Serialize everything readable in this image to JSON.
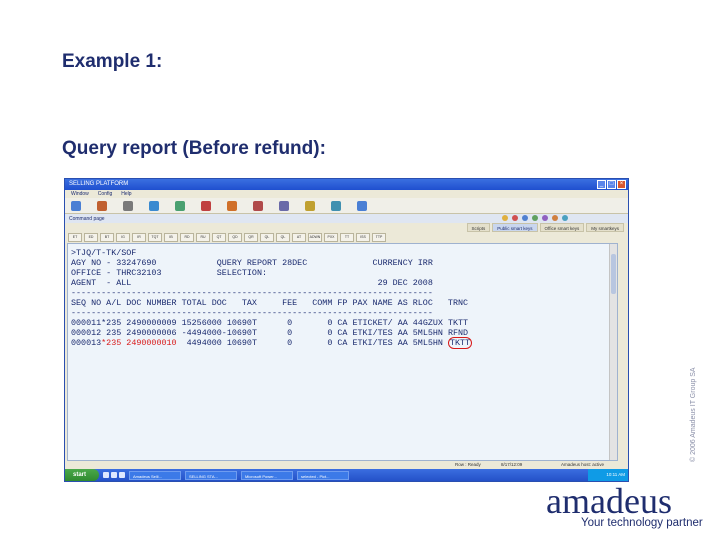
{
  "slide": {
    "heading1": "Example 1:",
    "heading2": "Query report (Before refund):",
    "copyright": "© 2006 Amadeus IT Group SA"
  },
  "window": {
    "title": "SELLING PLATFORM",
    "menu": [
      "Window",
      "Config",
      "Help"
    ],
    "toolbar_icons": [
      "home-icon",
      "users-icon",
      "car-icon",
      "plane-icon",
      "hotel-icon",
      "ship-icon",
      "person-icon",
      "person-icon",
      "calendar-icon",
      "mail-icon",
      "globe-icon",
      "plane-icon"
    ],
    "command_label": "Command page",
    "tabs": [
      {
        "label": "Scripts",
        "active": false
      },
      {
        "label": "Public smart keys",
        "active": true
      },
      {
        "label": "Office smart keys",
        "active": false
      },
      {
        "label": "My smartkeys",
        "active": false
      }
    ],
    "fkeys": [
      "ET",
      "ED",
      "BT",
      "IG",
      "IR",
      "TQT",
      "IB",
      "RD",
      "RU",
      "QT",
      "QD",
      "QR",
      "QL",
      "QL",
      "AT",
      "ADWN",
      "PXX",
      "TT",
      "ISS",
      "TTP"
    ]
  },
  "terminal": {
    "lines": [
      ">TJQ/T-TK/SOF",
      "AGY NO - 33247690            QUERY REPORT 28DEC             CURRENCY IRR",
      "OFFICE - THRC32103           SELECTION:",
      "AGENT  - ALL                                                 29 DEC 2008",
      "------------------------------------------------------------------------",
      "SEQ NO A/L DOC NUMBER TOTAL DOC   TAX     FEE   COMM FP PAX NAME AS RLOC   TRNC",
      "------------------------------------------------------------------------"
    ],
    "rows": [
      {
        "seq": "000011",
        "al": "*235",
        "doc": "2490000009",
        "rest": " 15256000 10690T      0       0 CA ETICKET/ AA 44GZUX ",
        "trnc": "TKTT",
        "highlight": false,
        "circled": false
      },
      {
        "seq": "000012",
        "al": " 235",
        "doc": "2490000006",
        "rest": " -4494000-10690T      0       0 CA ETKI/TES AA 5ML5HN ",
        "trnc": "RFND",
        "highlight": false,
        "circled": false
      },
      {
        "seq": "000013",
        "al": "*235",
        "doc": "2490000010",
        "rest": "  4494000 10690T      0       0 CA ETKI/TES AA 5ML5HN ",
        "trnc": "TKTT",
        "highlight": true,
        "circled": true
      }
    ]
  },
  "statusbar": {
    "left": "Row : Ready",
    "middle": "8/17/12:09",
    "right": "Amadeus host: active"
  },
  "taskbar": {
    "start": "start",
    "items": [
      "Amadeus Selli...",
      "SELLING STA...",
      "Microsoft Power...",
      "selected - Pict..."
    ],
    "tray": "10:11 AM"
  },
  "logo": {
    "wordmark": "amadeus",
    "tagline": "Your technology partner"
  },
  "colors": {
    "heading": "#1f2d6e",
    "terminal_text": "#1a2a6e",
    "highlight": "#d81a1a"
  }
}
